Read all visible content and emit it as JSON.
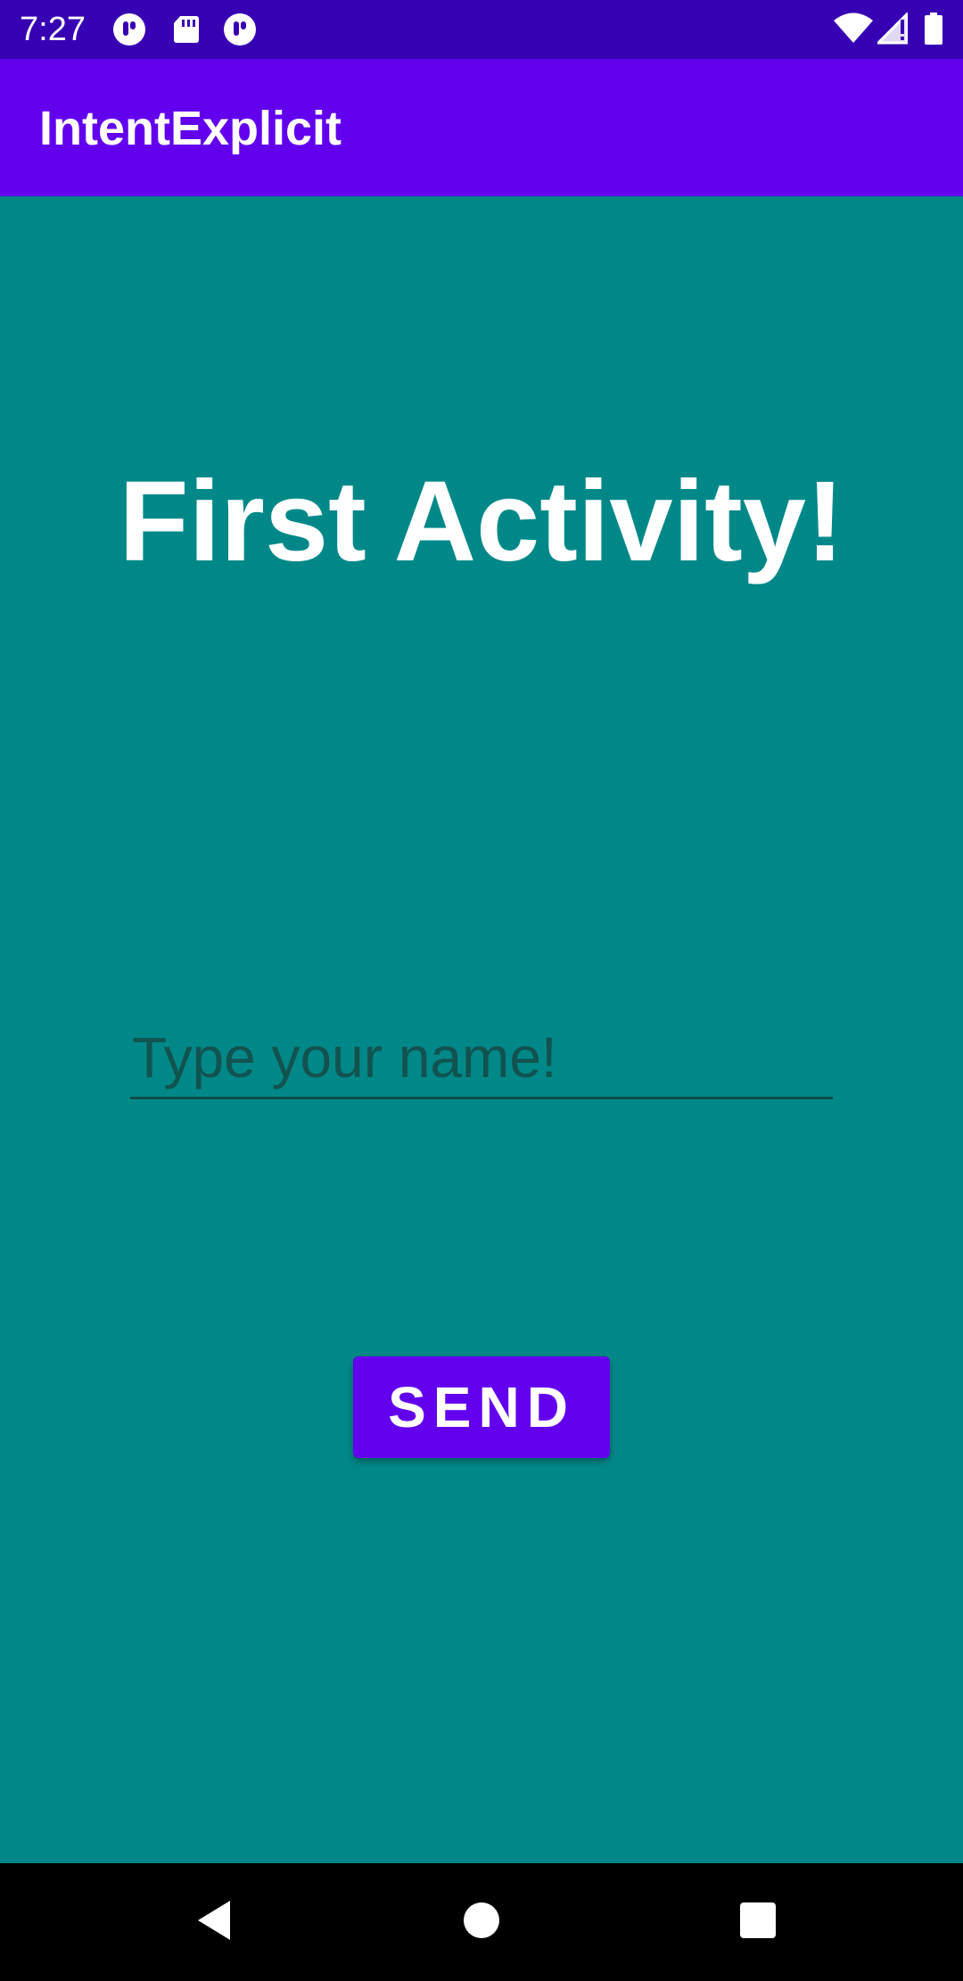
{
  "status_bar": {
    "time": "7:27",
    "notification_icons": [
      "app-notification-icon",
      "sd-card-icon",
      "app-notification-icon"
    ],
    "system_icons": [
      "wifi-icon",
      "signal-icon",
      "battery-icon"
    ]
  },
  "app_bar": {
    "title": "IntentExplicit"
  },
  "main": {
    "heading": "First Activity!",
    "name_input": {
      "value": "",
      "placeholder": "Type your name!"
    },
    "send_label": "SEND"
  },
  "nav_bar": {
    "buttons": [
      "back-icon",
      "home-icon",
      "recents-icon"
    ]
  },
  "colors": {
    "status_bar": "#3700B3",
    "app_bar": "#6200EE",
    "background": "#008888",
    "button": "#6200EE"
  }
}
